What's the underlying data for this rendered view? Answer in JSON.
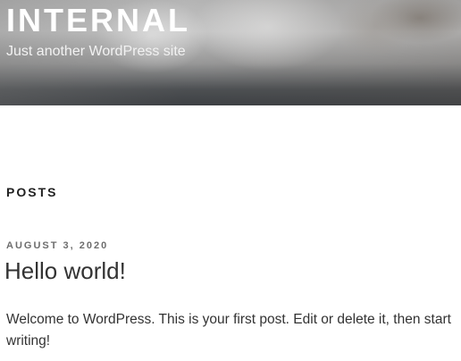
{
  "header": {
    "site_title": "INTERNAL",
    "tagline": "Just another WordPress site"
  },
  "main": {
    "section_title": "POSTS",
    "posts": [
      {
        "date": "AUGUST 3, 2020",
        "title": "Hello world!",
        "excerpt": "Welcome to WordPress. This is your first post. Edit or delete it, then start writing!"
      }
    ]
  }
}
